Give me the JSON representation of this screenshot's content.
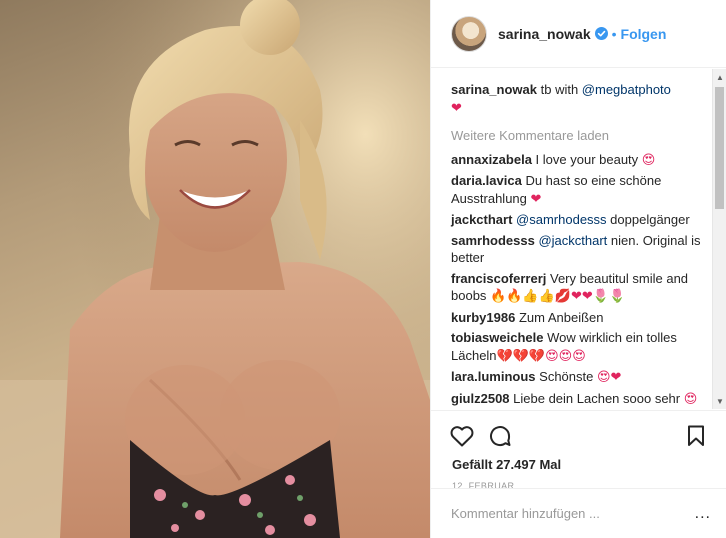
{
  "post": {
    "image_alt": "Photo by sarina_nowak"
  },
  "header": {
    "username": "sarina_nowak",
    "separator": "•",
    "follow_label": "Folgen"
  },
  "caption": {
    "username": "sarina_nowak",
    "text": " tb with ",
    "mention": "@megbatphoto",
    "emoji": "❤"
  },
  "load_more_label": "Weitere Kommentare laden",
  "comments": [
    {
      "user": "annaxizabela",
      "text": " I love your beauty ",
      "mention": "",
      "after": "",
      "emoji": "😍"
    },
    {
      "user": "daria.lavica",
      "text": " Du hast so eine schöne Ausstrahlung ",
      "mention": "",
      "after": "",
      "emoji": "❤"
    },
    {
      "user": "jackcthart",
      "text": " ",
      "mention": "@samrhodesss",
      "after": " doppelgänger",
      "emoji": ""
    },
    {
      "user": "samrhodesss",
      "text": " ",
      "mention": "@jackcthart",
      "after": " nien. Original is better",
      "emoji": ""
    },
    {
      "user": "franciscoferrerj",
      "text": " Very beautitul smile and boobs ",
      "mention": "",
      "after": "",
      "emoji": "🔥🔥👍👍💋❤❤🌷🌷"
    },
    {
      "user": "kurby1986",
      "text": " Zum Anbeißen",
      "mention": "",
      "after": "",
      "emoji": ""
    },
    {
      "user": "tobiasweichele",
      "text": " Wow wirklich ein tolles Lächeln",
      "mention": "",
      "after": "",
      "emoji": "💔💔💔😍😍😍"
    },
    {
      "user": "lara.luminous",
      "text": " Schönste ",
      "mention": "",
      "after": "",
      "emoji": "😍❤"
    },
    {
      "user": "giulz2508",
      "text": " Liebe dein Lachen sooo sehr ",
      "mention": "",
      "after": "",
      "emoji": "😍"
    }
  ],
  "actions": {
    "like_icon": "heart-outline-icon",
    "comment_icon": "speech-bubble-icon",
    "save_icon": "bookmark-icon"
  },
  "likes_label": "Gefällt 27.497 Mal",
  "date_label": "12. FEBRUAR",
  "add_comment": {
    "placeholder": "Kommentar hinzufügen ...",
    "more_label": "..."
  },
  "colors": {
    "accent": "#3897f0",
    "mention": "#003569",
    "muted": "#999999",
    "heart": "#e0245e"
  }
}
